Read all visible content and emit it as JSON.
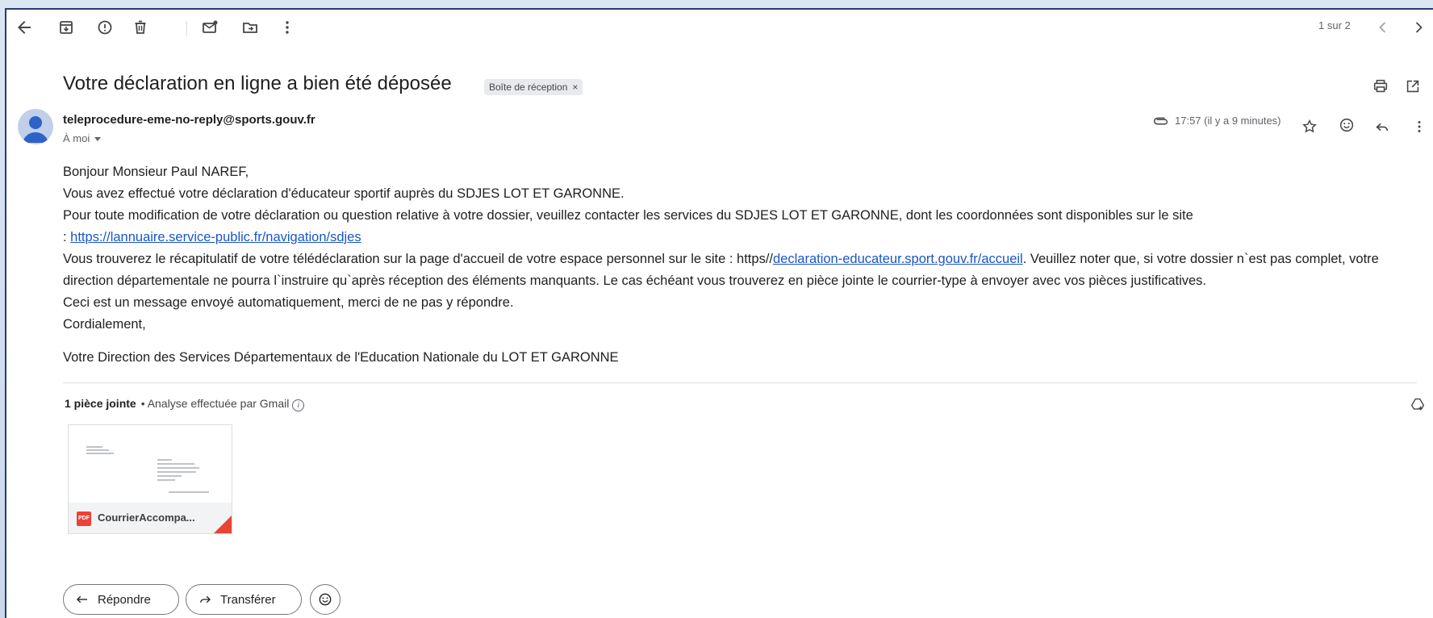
{
  "toolbar": {
    "pager": "1 sur 2"
  },
  "message": {
    "subject": "Votre déclaration en ligne a bien été déposée",
    "label": "Boîte de réception",
    "label_remove": "×",
    "sender": "teleprocedure-eme-no-reply@sports.gouv.fr",
    "recipient": "À moi",
    "time": "17:57 (il y a 9 minutes)"
  },
  "body": {
    "greeting": "Bonjour Monsieur Paul NAREF,",
    "line1": "Vous avez effectué votre déclaration d'éducateur sportif auprès du SDJES LOT ET GARONNE.",
    "line2_text": "Pour toute modification de votre déclaration ou question relative à votre dossier, veuillez contacter les services du SDJES LOT ET GARONNE, dont les coordonnées sont disponibles sur le site",
    "line2_prefix": ": ",
    "line2_link": "https://lannuaire.service-public.fr/navigation/sdjes",
    "line3_before": "Vous trouverez le récapitulatif de votre télédéclaration sur la page d'accueil de votre espace personnel sur le site : https//",
    "line3_link": "declaration-educateur.sport.gouv.fr/accueil",
    "line3_after": ". Veuillez noter que, si votre dossier n`est pas complet, votre direction départementale ne pourra l`instruire qu`après réception des éléments manquants. Le cas échéant vous trouverez en pièce jointe le courrier-type à envoyer avec vos pièces justificatives.",
    "line4": "Ceci est un message envoyé automatiquement, merci de ne pas y répondre.",
    "closing": "Cordialement,",
    "signature": "Votre Direction des Services Départementaux de l'Education Nationale du LOT ET GARONNE"
  },
  "attachments": {
    "count_label": "1 pièce jointe",
    "scan_label": "• Analyse effectuée par Gmail",
    "info_glyph": "i",
    "file_type": "PDF",
    "file_name": "CourrierAccompa..."
  },
  "actions": {
    "reply": "Répondre",
    "forward": "Transférer"
  },
  "colors": {
    "link": "#1a56c8",
    "pdf": "#ea4335"
  }
}
